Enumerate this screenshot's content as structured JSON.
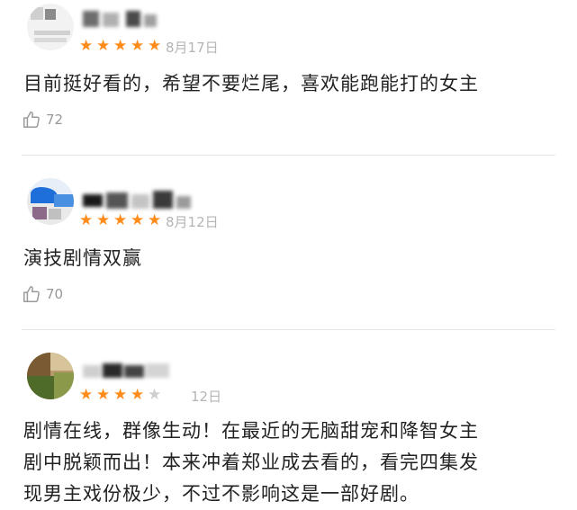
{
  "reviews": [
    {
      "rating": 5,
      "date": "8月17日",
      "text": "目前挺好看的，希望不要烂尾，喜欢能跑能打的女主",
      "likes": "72"
    },
    {
      "rating": 5,
      "date": "8月12日",
      "text": "演技剧情双赢",
      "likes": "70"
    },
    {
      "rating": 4,
      "date": "12日",
      "text_lines": [
        "剧情在线，群像生动！在最近的无脑甜宠和降智女主",
        "剧中脱颖而出！本来冲着郑业成去看的，看完四集发",
        "现男主戏份极少，不过不影响这是一部好剧。"
      ],
      "likes": ""
    }
  ],
  "colors": {
    "star": "#ff8c1a",
    "star_empty": "#cfcfcf",
    "text": "#222222",
    "meta": "#b5b5b5"
  },
  "icons": {
    "like": "thumbs-up-icon",
    "star": "star-icon"
  }
}
